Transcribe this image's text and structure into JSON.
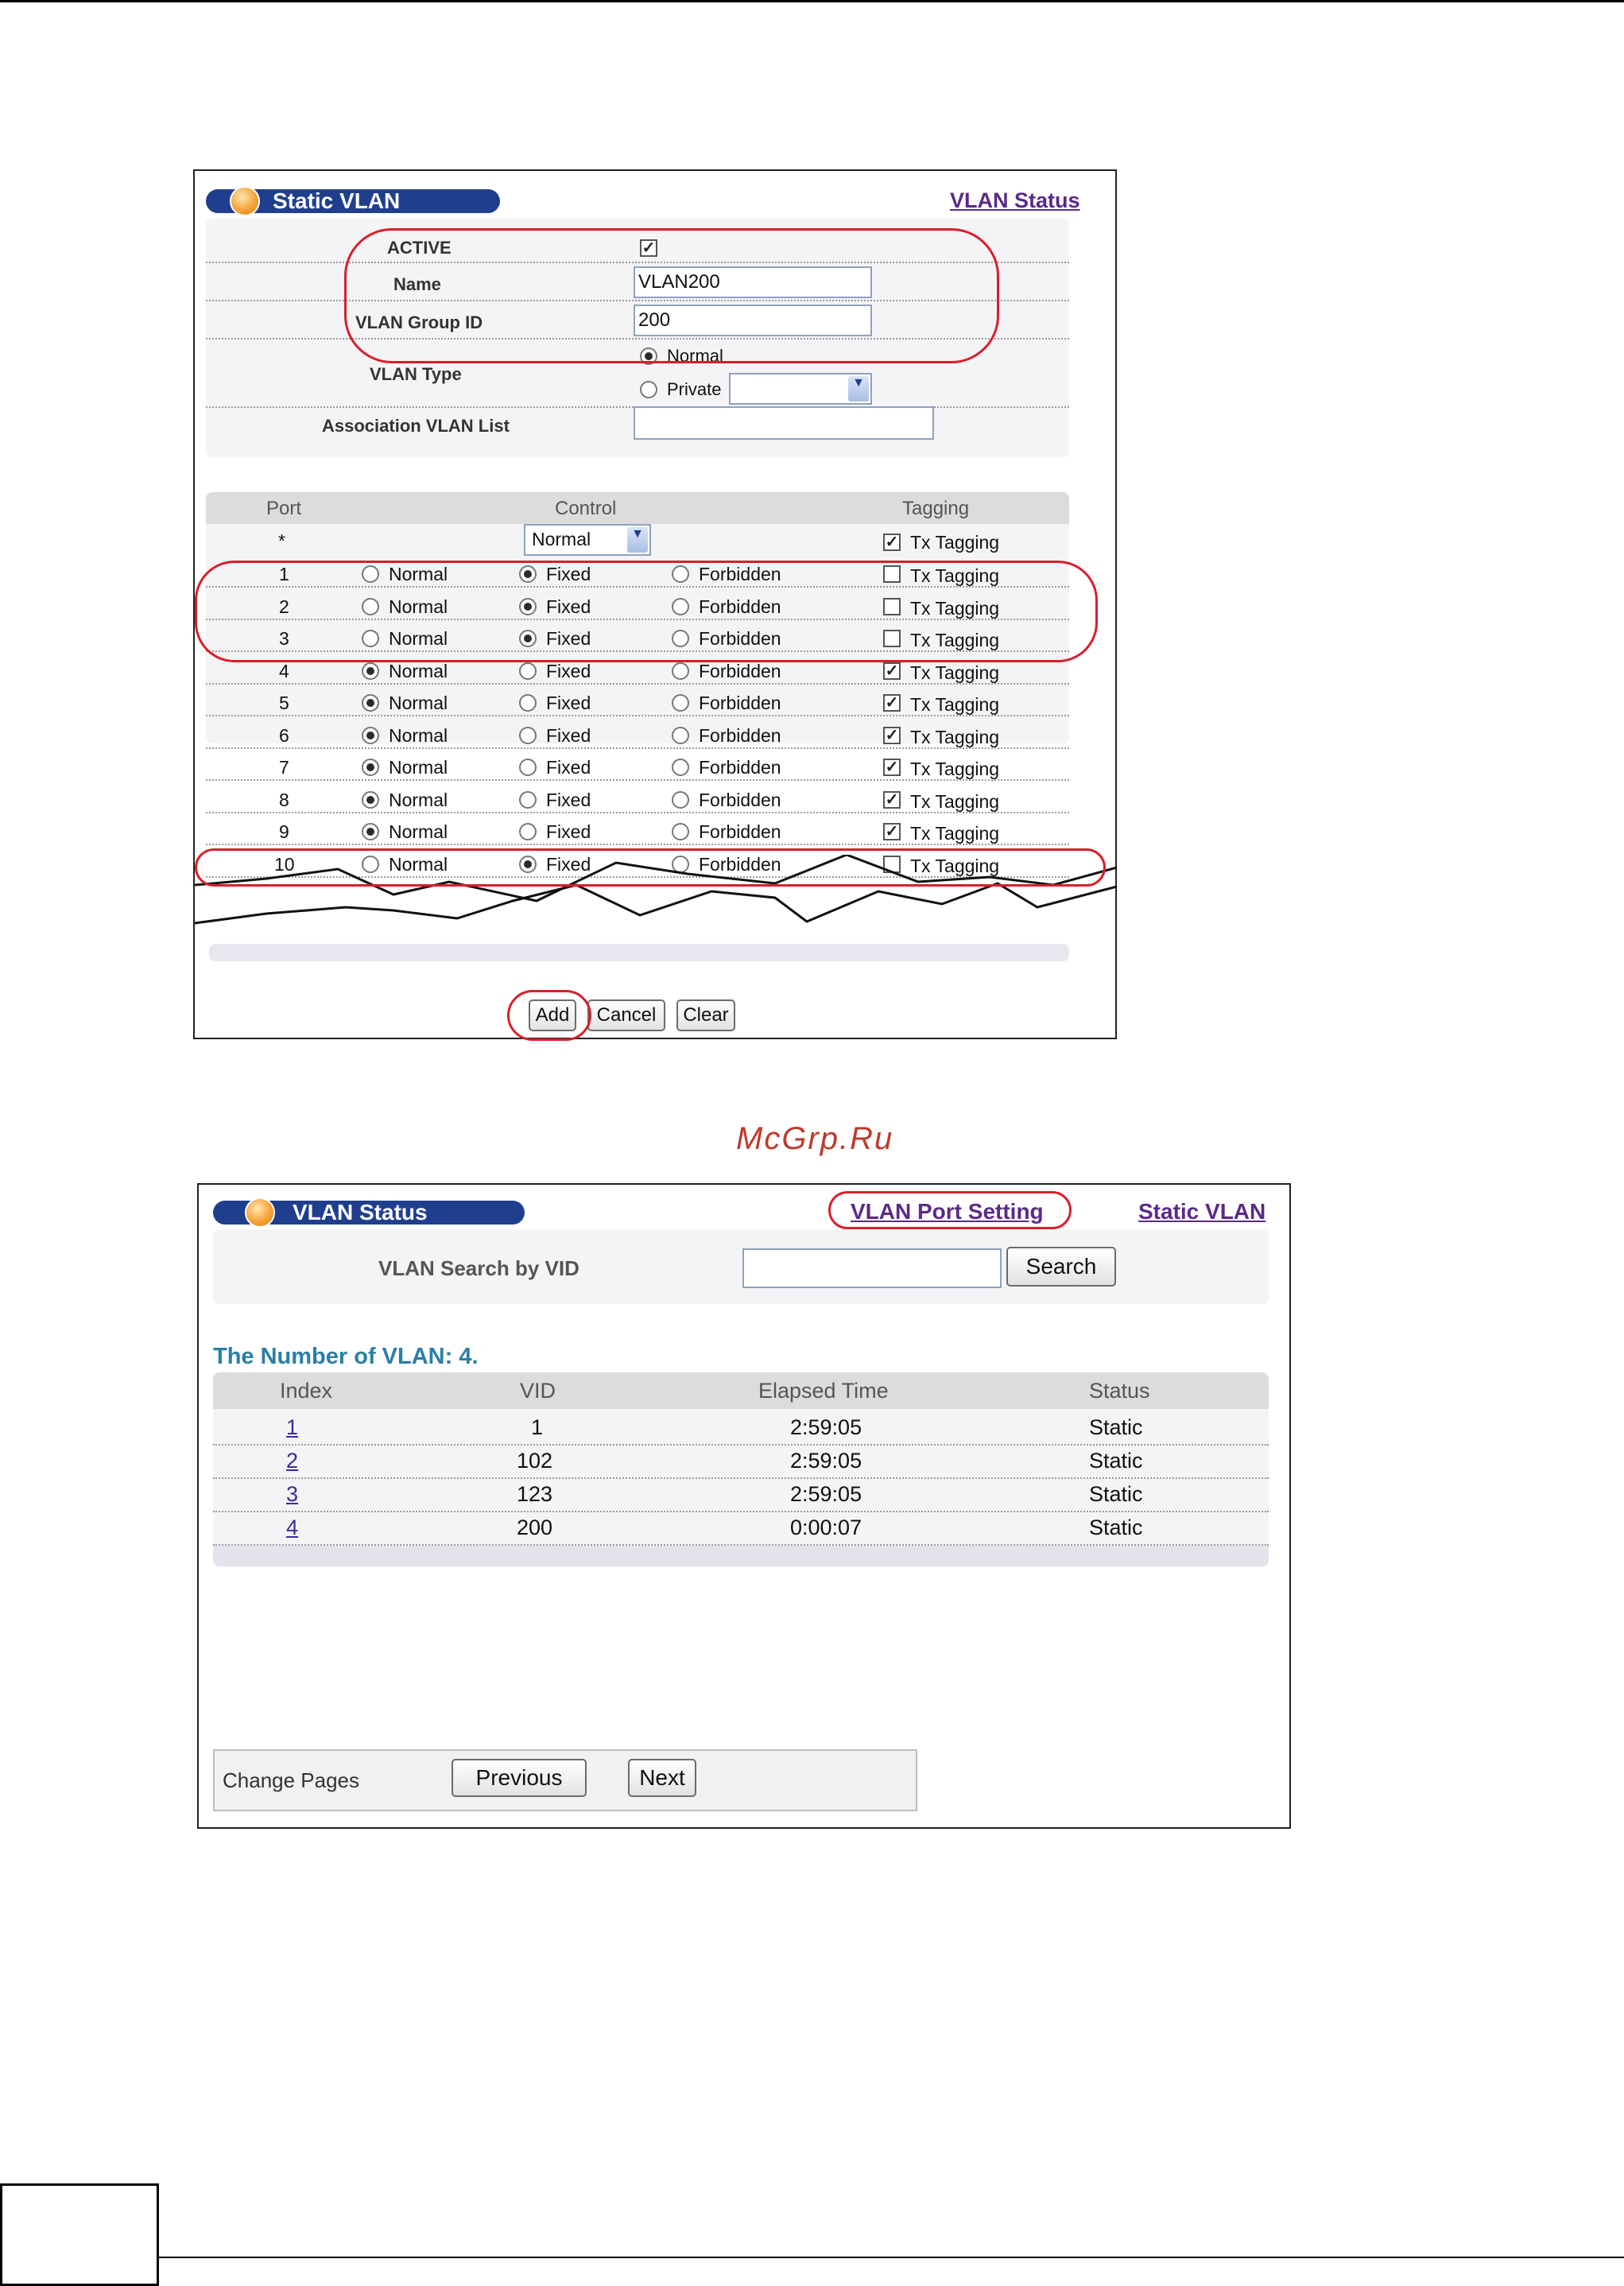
{
  "static_vlan": {
    "title": "Static VLAN",
    "status_link": "VLAN Status",
    "active_label": "ACTIVE",
    "active_checked": true,
    "name_label": "Name",
    "name_value": "VLAN200",
    "group_id_label": "VLAN Group ID",
    "group_id_value": "200",
    "vlan_type_label": "VLAN Type",
    "type_normal": "Normal",
    "type_private": "Private",
    "assoc_label": "Association VLAN List",
    "assoc_value": "",
    "col_port": "Port",
    "col_control": "Control",
    "col_tagging": "Tagging",
    "all_port": "*",
    "all_control_value": "Normal",
    "tx_label": "Tx Tagging",
    "opt_normal": "Normal",
    "opt_fixed": "Fixed",
    "opt_forbidden": "Forbidden",
    "ports": [
      {
        "port": "1",
        "control": "fixed",
        "tx": false
      },
      {
        "port": "2",
        "control": "fixed",
        "tx": false
      },
      {
        "port": "3",
        "control": "fixed",
        "tx": false
      },
      {
        "port": "4",
        "control": "normal",
        "tx": true
      },
      {
        "port": "5",
        "control": "normal",
        "tx": true
      },
      {
        "port": "6",
        "control": "normal",
        "tx": true
      },
      {
        "port": "7",
        "control": "normal",
        "tx": true
      },
      {
        "port": "8",
        "control": "normal",
        "tx": true
      },
      {
        "port": "9",
        "control": "normal",
        "tx": true
      },
      {
        "port": "10",
        "control": "fixed",
        "tx": false
      }
    ],
    "btn_add": "Add",
    "btn_cancel": "Cancel",
    "btn_clear": "Clear"
  },
  "watermark": "McGrp.Ru",
  "vlan_status": {
    "title": "VLAN Status",
    "port_setting_link": "VLAN Port Setting",
    "static_link": "Static VLAN",
    "search_label": "VLAN Search by VID",
    "search_value": "",
    "search_btn": "Search",
    "count_text": "The Number of VLAN: 4.",
    "headers": [
      "Index",
      "VID",
      "Elapsed Time",
      "Status"
    ],
    "rows": [
      {
        "index": "1",
        "vid": "1",
        "elapsed": "2:59:05",
        "status": "Static"
      },
      {
        "index": "2",
        "vid": "102",
        "elapsed": "2:59:05",
        "status": "Static"
      },
      {
        "index": "3",
        "vid": "123",
        "elapsed": "2:59:05",
        "status": "Static"
      },
      {
        "index": "4",
        "vid": "200",
        "elapsed": "0:00:07",
        "status": "Static"
      }
    ],
    "change_pages": "Change Pages",
    "prev_btn": "Previous",
    "next_btn": "Next"
  },
  "colors": {
    "accent": "#1f3f8e",
    "link": "#5b2a86",
    "highlight": "#d81f2a",
    "count_text": "#2a7fa5"
  }
}
